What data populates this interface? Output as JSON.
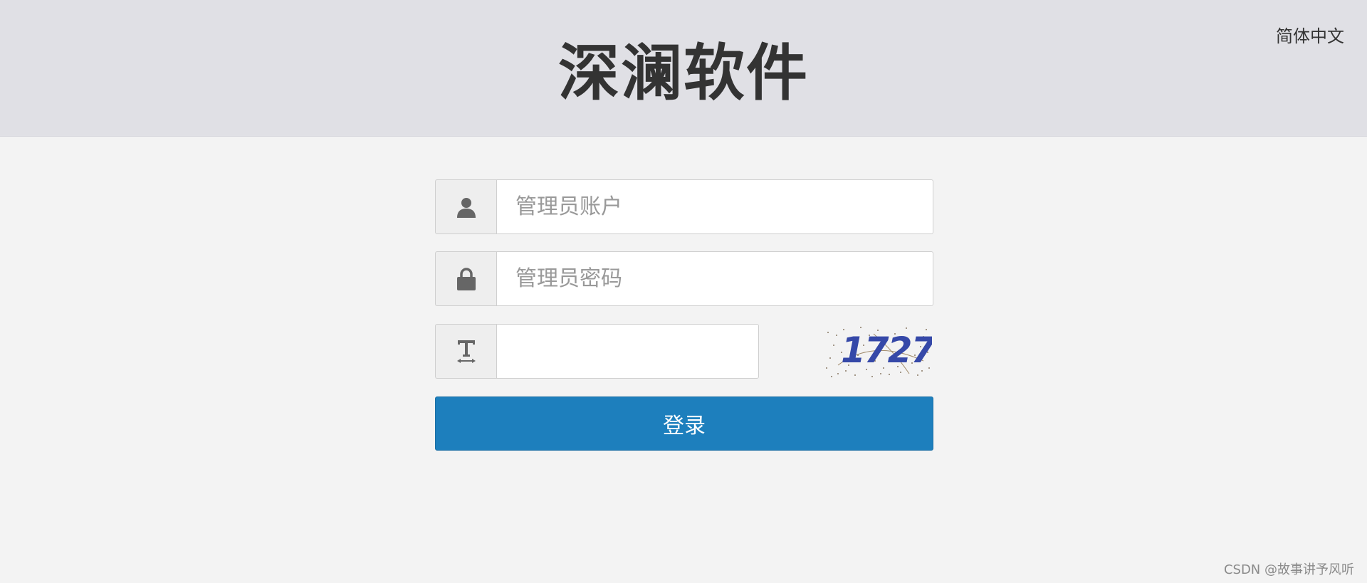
{
  "header": {
    "title": "深澜软件",
    "language": "简体中文"
  },
  "form": {
    "username": {
      "placeholder": "管理员账户",
      "value": "",
      "icon": "user-icon"
    },
    "password": {
      "placeholder": "管理员密码",
      "value": "",
      "icon": "lock-icon"
    },
    "captcha": {
      "placeholder": "",
      "value": "",
      "icon": "text-icon",
      "image_text": "1727"
    },
    "submit_label": "登录"
  },
  "watermark": "CSDN @故事讲予风听",
  "colors": {
    "header_bg": "#e0e0e5",
    "page_bg": "#f3f3f3",
    "primary": "#1d7fbd",
    "captcha_text": "#3548a8"
  }
}
